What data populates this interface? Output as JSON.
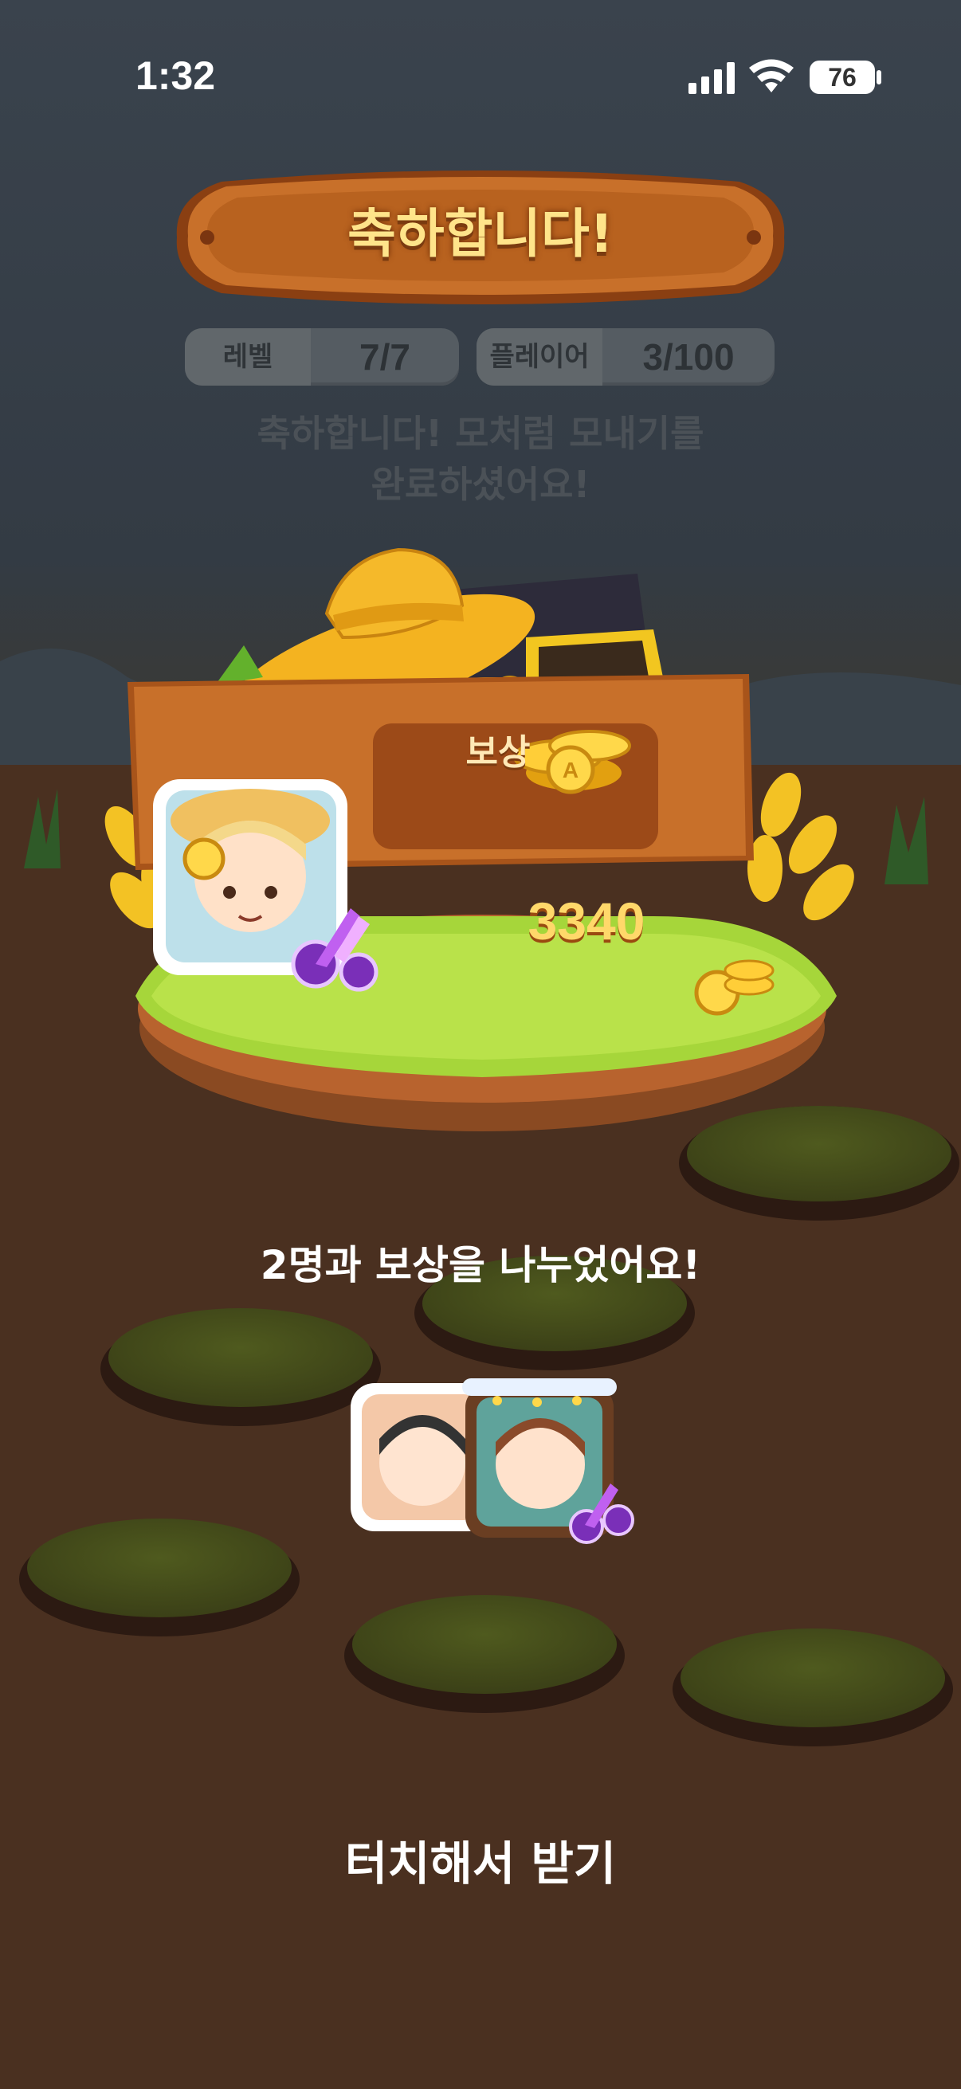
{
  "status_bar": {
    "time": "1:32",
    "battery": "76"
  },
  "header": {
    "title": "축하합니다!"
  },
  "stats": {
    "level_label": "레벨",
    "level_value": "7/7",
    "player_label": "플레이어",
    "player_value": "3/100"
  },
  "message": {
    "line1": "축하합니다! 모처럼 모내기를",
    "line2": "완료하셨어요!"
  },
  "reward": {
    "label": "보상",
    "amount": "3340"
  },
  "share": {
    "text": "2명과 보상을 나누었어요!"
  },
  "cta": {
    "text": "터치해서 받기"
  },
  "colors": {
    "title_text": "#ffe48a",
    "wood": "#c06a22",
    "grass": "#a6d63a",
    "reward_text": "#ffd86a"
  },
  "icons": [
    "signal-icon",
    "wifi-icon",
    "battery-icon",
    "coin-icon",
    "scissors-icon",
    "straw-hat-icon",
    "treasure-chest-icon"
  ]
}
